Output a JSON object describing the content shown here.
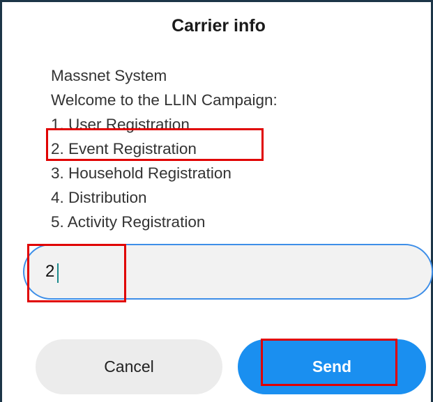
{
  "dialog": {
    "title": "Carrier info",
    "message_lines": [
      "Massnet System",
      "Welcome to the LLIN Campaign:",
      "1. User Registration",
      "2. Event Registration",
      "3. Household Registration",
      "4. Distribution",
      "5. Activity Registration"
    ],
    "input_value": "2",
    "cancel_label": "Cancel",
    "send_label": "Send"
  },
  "colors": {
    "send_button": "#1a8ff0",
    "cancel_button": "#ececec",
    "input_border": "#3d8ee8",
    "highlight": "#e00000"
  }
}
